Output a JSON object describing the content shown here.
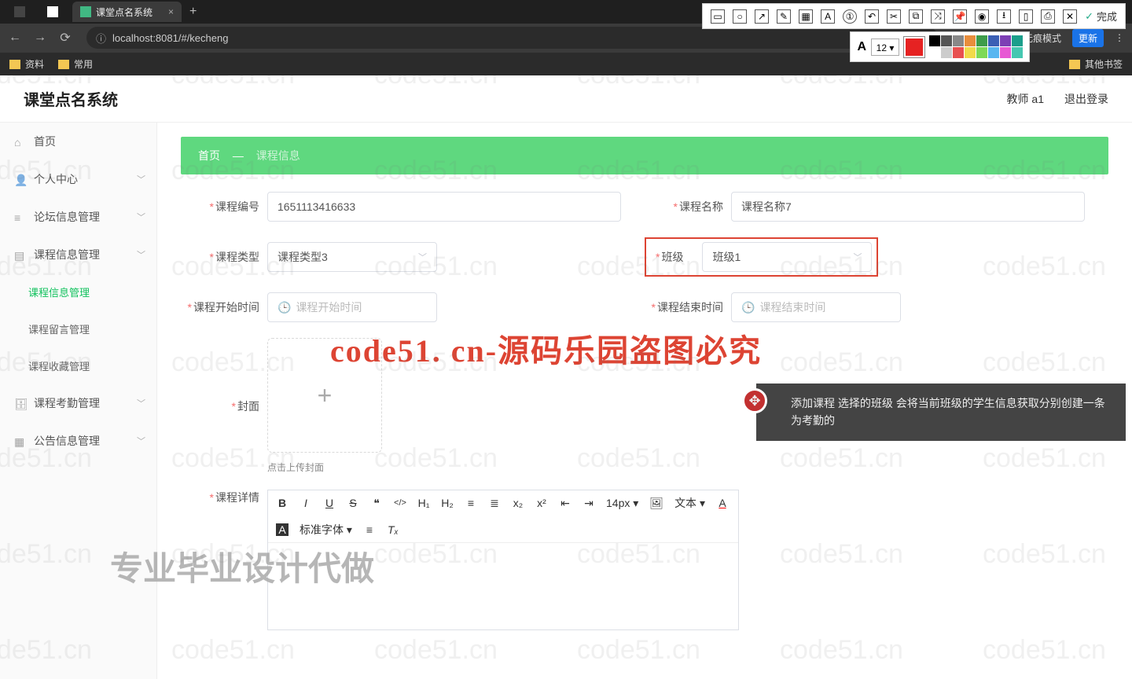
{
  "browser": {
    "tab_title": "课堂点名系统",
    "new_tab": "+",
    "addr": "localhost:8081/#/kecheng",
    "addr_host": "localhost",
    "nav_back": "←",
    "nav_fwd": "→",
    "nav_reload": "⟳",
    "incognito": "无痕模式",
    "update": "更新",
    "bm1": "资料",
    "bm2": "常用",
    "bm_other": "其他书签"
  },
  "annotool": {
    "fontsize": "12",
    "done": "完成",
    "done_check": "✓",
    "colors_row1": [
      "#000",
      "#555",
      "#888",
      "#e88d3c",
      "#3d9c4a",
      "#3b5fb5",
      "#7d3fb5",
      "#1b9e8b"
    ],
    "colors_row2": [
      "#fff",
      "#ccc",
      "#e85050",
      "#f1da4a",
      "#7dd957",
      "#58b6f0",
      "#e759d4",
      "#45c7b1"
    ],
    "main_color": "#e62222"
  },
  "header": {
    "title": "课堂点名系统",
    "user": "教师 a1",
    "logout": "退出登录"
  },
  "sidebar": {
    "home": "首页",
    "profile": "个人中心",
    "forum": "论坛信息管理",
    "course": "课程信息管理",
    "course_info": "课程信息管理",
    "course_msg": "课程留言管理",
    "course_fav": "课程收藏管理",
    "attend": "课程考勤管理",
    "notice": "公告信息管理"
  },
  "breadcrumb": {
    "home": "首页",
    "cur": "课程信息",
    "arrow": "—"
  },
  "form": {
    "code_label": "课程编号",
    "code_val": "1651113416633",
    "name_label": "课程名称",
    "name_val": "课程名称7",
    "type_label": "课程类型",
    "type_val": "课程类型3",
    "class_label": "班级",
    "class_val": "班级1",
    "start_label": "课程开始时间",
    "start_ph": "课程开始时间",
    "end_label": "课程结束时间",
    "end_ph": "课程结束时间",
    "cover_label": "封面",
    "cover_icon": "+",
    "cover_hint": "点击上传封面",
    "detail_label": "课程详情"
  },
  "editor": {
    "bold": "B",
    "italic": "I",
    "underline": "U",
    "strike": "S",
    "quote": "❝",
    "code": "</>",
    "h1": "H₁",
    "h2": "H₂",
    "ol": "≡",
    "ul": "≣",
    "sub": "x₂",
    "sup": "x²",
    "indent_dec": "⇤",
    "indent_inc": "⇥",
    "size": "14px",
    "para": "文本",
    "font": "标准字体",
    "color": "A",
    "bg": "A",
    "align": "≡",
    "clear": "Tₓ"
  },
  "toast": {
    "icon": "✥",
    "text": "添加课程 选择的班级   会将当前班级的学生信息获取分别创建一条为考勤的"
  },
  "watermark": {
    "red": "code51. cn-源码乐园盗图必究",
    "gray": "专业毕业设计代做",
    "bg": "code51.cn"
  }
}
